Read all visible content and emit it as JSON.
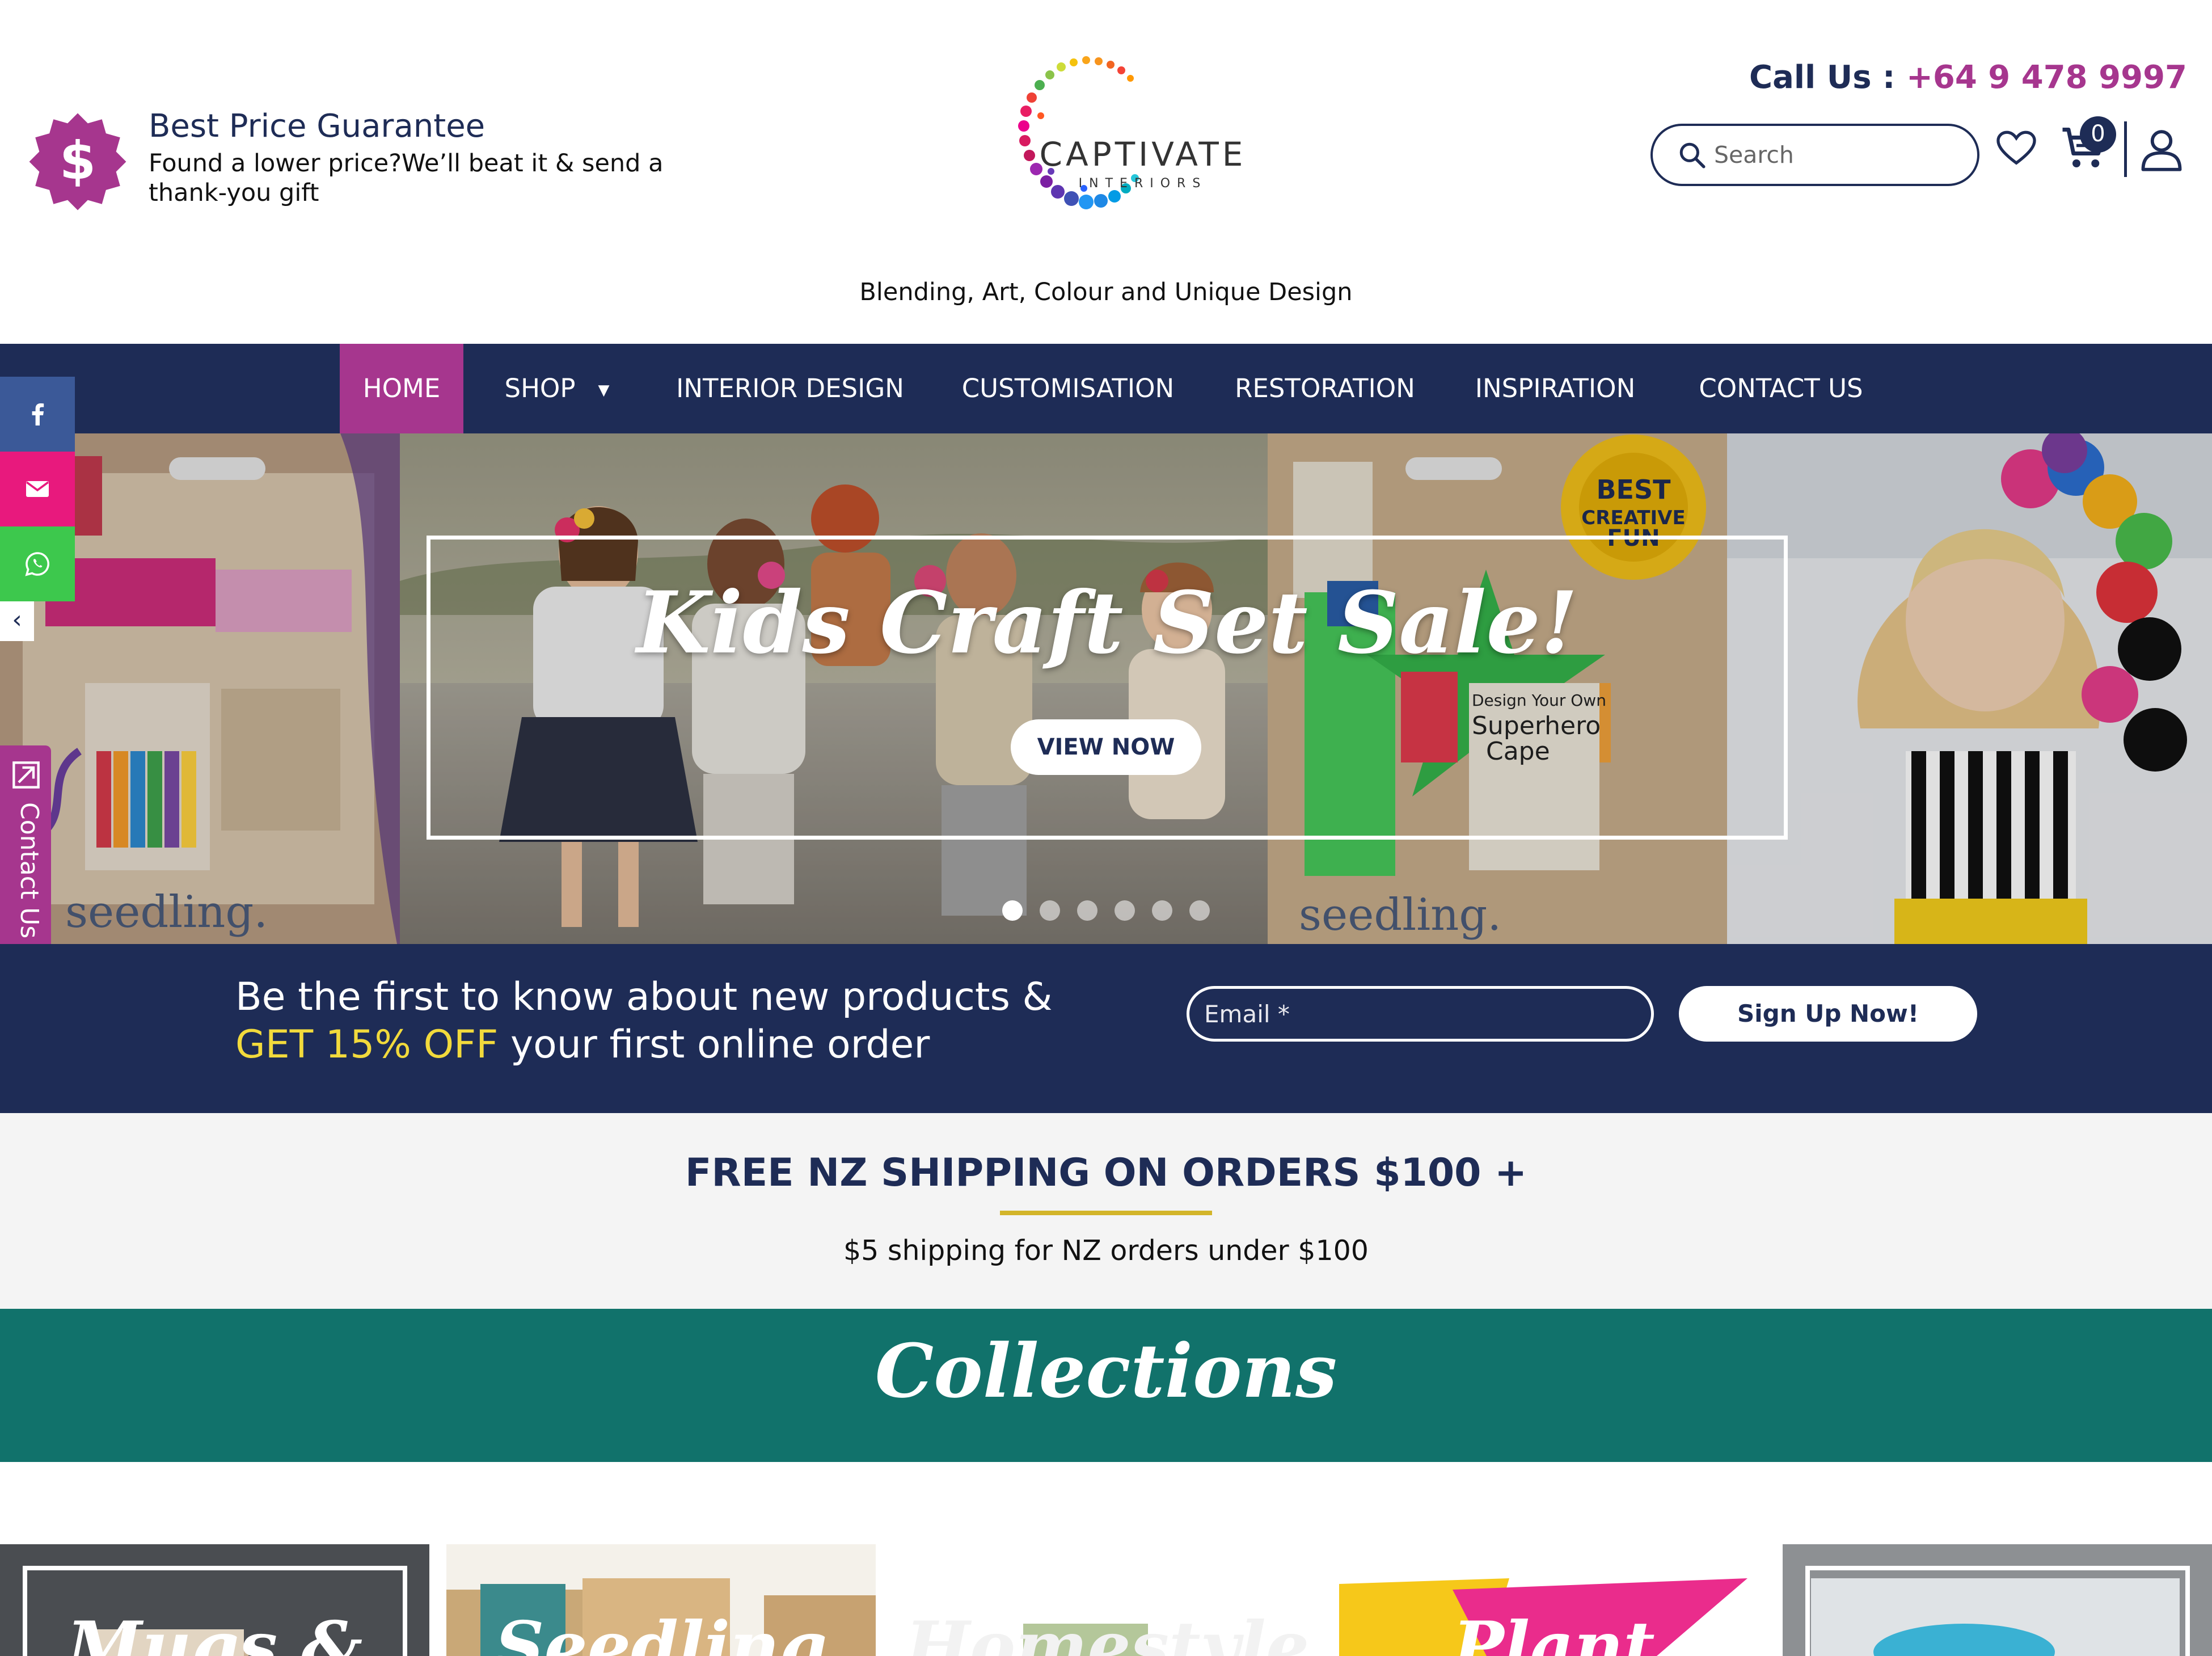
{
  "header": {
    "best_price_title": "Best Price Guarantee",
    "best_price_desc": "Found a lower price?We’ll beat it & send a thank-you gift",
    "badge_symbol": "$",
    "logo_name": "CAPTIVATE",
    "logo_sub": "INTERIORS",
    "tagline": "Blending, Art, Colour and Unique Design",
    "call_label": "Call Us :",
    "phone": "+64 9 478 9997",
    "search_placeholder": "Search",
    "cart_count": "0"
  },
  "nav": {
    "items": [
      {
        "label": "HOME",
        "active": true
      },
      {
        "label": "SHOP",
        "has_dropdown": true
      },
      {
        "label": "INTERIOR DESIGN"
      },
      {
        "label": "CUSTOMISATION"
      },
      {
        "label": "RESTORATION"
      },
      {
        "label": "INSPIRATION"
      },
      {
        "label": "CONTACT US"
      }
    ],
    "dropdown_caret": "▼"
  },
  "social": {
    "items": [
      {
        "name": "facebook",
        "color": "#3b5998"
      },
      {
        "name": "email",
        "color": "#e8197d"
      },
      {
        "name": "whatsapp",
        "color": "#3dc84d"
      }
    ],
    "collapse_glyph": "‹",
    "contact_tab": "Contact Us"
  },
  "hero": {
    "title": "Kids Craft Set Sale!",
    "button": "VIEW NOW",
    "slides": 6,
    "active_slide": 1
  },
  "newsletter": {
    "line1": "Be the first to know about new products &",
    "highlight": "GET 15% OFF",
    "line2_rest": " your first online order",
    "email_placeholder": "Email *",
    "button": "Sign Up Now!"
  },
  "shipping": {
    "title": "FREE NZ SHIPPING ON ORDERS $100 +",
    "subtitle": "$5 shipping for NZ orders under $100"
  },
  "collections": {
    "title": "Collections",
    "cards": [
      {
        "label": "Mugs &"
      },
      {
        "label": "Seedling"
      },
      {
        "label": "Homestyle"
      },
      {
        "label": "Plant"
      },
      {
        "label": ""
      }
    ]
  },
  "colors": {
    "navy": "#1e2c56",
    "magenta": "#a6368e",
    "teal": "#11726b",
    "gold": "#d3b52a",
    "highlight_yellow": "#f2da3c"
  }
}
